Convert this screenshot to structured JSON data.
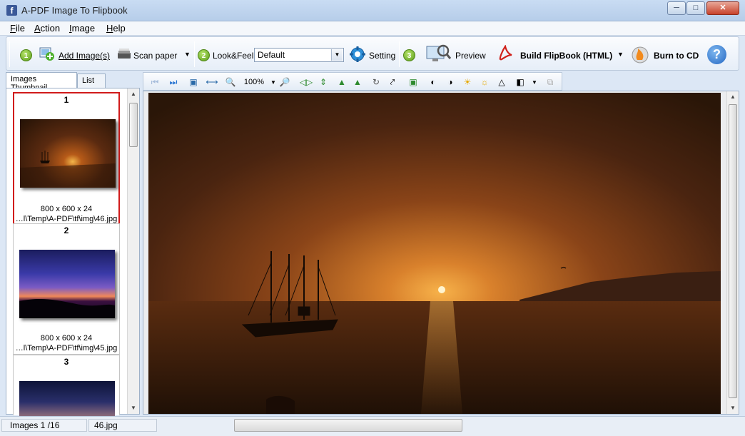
{
  "window": {
    "title": "A-PDF Image To Flipbook",
    "app_icon_glyph": "f"
  },
  "menu": [
    {
      "mnemonic": "F",
      "rest": "ile"
    },
    {
      "mnemonic": "A",
      "rest": "ction"
    },
    {
      "mnemonic": "I",
      "rest": "mage"
    },
    {
      "mnemonic": "H",
      "rest": "elp"
    }
  ],
  "toolbar": {
    "step1": "1",
    "add_image": "Add Image(s)",
    "scan_paper": "Scan paper",
    "step2": "2",
    "look_feel_label": "Look&Feel:",
    "look_feel_value": "Default",
    "setting": "Setting",
    "step3": "3",
    "preview": "Preview",
    "build": "Build FlipBook (HTML)",
    "burn": "Burn to CD"
  },
  "tabs": {
    "thumbnail": "Images Thumbnail",
    "list": "List"
  },
  "thumbnails": [
    {
      "index": "1",
      "size": "800 x 600 x 24",
      "path": "…l\\Temp\\A-PDF\\tf\\img\\46.jpg",
      "selected": true
    },
    {
      "index": "2",
      "size": "800 x 600 x 24",
      "path": "…l\\Temp\\A-PDF\\tf\\img\\45.jpg",
      "selected": false
    },
    {
      "index": "3",
      "size": "",
      "path": "",
      "selected": false
    }
  ],
  "image_toolbar": {
    "zoom": "100%"
  },
  "status": {
    "images": "Images 1 /16",
    "filename": "46.jpg"
  },
  "colors": {
    "selection": "#d11b1b",
    "chrome": "#dce7f5",
    "help": "#3a7ed8"
  }
}
